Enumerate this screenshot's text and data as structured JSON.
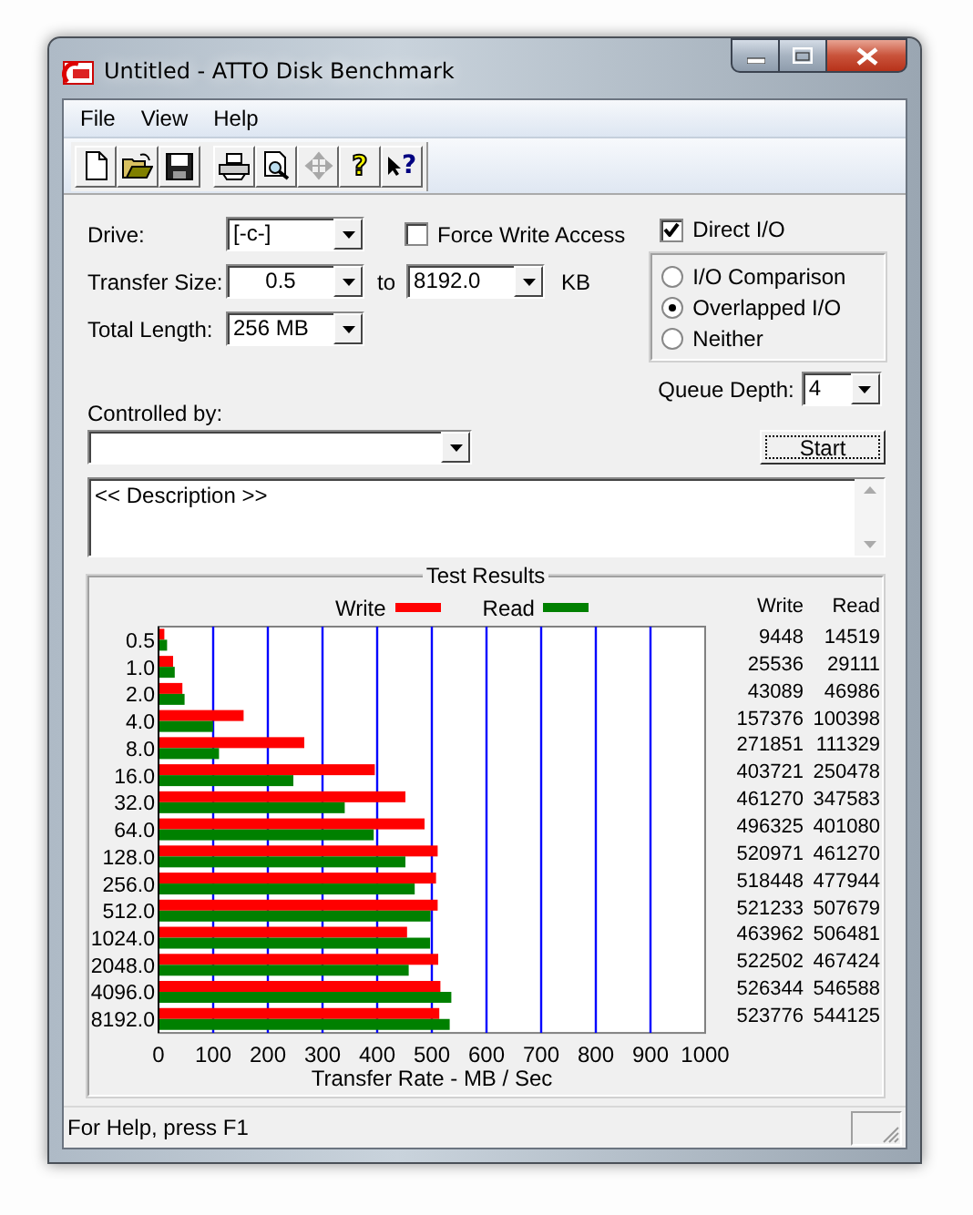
{
  "window": {
    "title": "Untitled - ATTO Disk Benchmark"
  },
  "menu": [
    "File",
    "View",
    "Help"
  ],
  "toolbar": [
    {
      "kind": "new",
      "disabled": false
    },
    {
      "kind": "open",
      "disabled": false
    },
    {
      "kind": "save",
      "disabled": false
    },
    {
      "kind": "print",
      "disabled": false
    },
    {
      "kind": "preview",
      "disabled": false
    },
    {
      "kind": "move",
      "disabled": true
    },
    {
      "kind": "help",
      "glyph": "?",
      "disabled": false
    },
    {
      "kind": "context_help",
      "glyph": "?",
      "disabled": false
    }
  ],
  "settings": {
    "drive": {
      "label": "Drive:",
      "value": "[-c-]"
    },
    "force_write_access": {
      "label": "Force Write Access",
      "checked": false
    },
    "transfer_size": {
      "label": "Transfer Size:",
      "from": "0.5",
      "to_label": "to",
      "to": "8192.0",
      "unit": "KB"
    },
    "total_length": {
      "label": "Total Length:",
      "value": "256 MB"
    },
    "direct_io": {
      "label": "Direct I/O",
      "checked": true
    },
    "io_mode": [
      {
        "label": "I/O Comparison",
        "selected": false
      },
      {
        "label": "Overlapped I/O",
        "selected": true
      },
      {
        "label": "Neither",
        "selected": false
      }
    ],
    "queue_depth": {
      "label": "Queue Depth:",
      "value": "4"
    },
    "controlled_by": {
      "label": "Controlled by:"
    },
    "start_button": "Start",
    "description": "<< Description >>"
  },
  "results": {
    "title": "Test Results",
    "columns": [
      "Write",
      "Read"
    ],
    "rows": [
      [
        "9448",
        "14519"
      ],
      [
        "25536",
        "29111"
      ],
      [
        "43089",
        "46986"
      ],
      [
        "157376",
        "100398"
      ],
      [
        "271851",
        "111329"
      ],
      [
        "403721",
        "250478"
      ],
      [
        "461270",
        "347583"
      ],
      [
        "496325",
        "401080"
      ],
      [
        "520971",
        "461270"
      ],
      [
        "518448",
        "477944"
      ],
      [
        "521233",
        "507679"
      ],
      [
        "463962",
        "506481"
      ],
      [
        "522502",
        "467424"
      ],
      [
        "526344",
        "546588"
      ],
      [
        "523776",
        "544125"
      ]
    ],
    "chart_data": {
      "type": "bar",
      "orientation": "horizontal",
      "xlabel": "Transfer Rate - MB / Sec",
      "categories": [
        "0.5",
        "1.0",
        "2.0",
        "4.0",
        "8.0",
        "16.0",
        "32.0",
        "64.0",
        "128.0",
        "256.0",
        "512.0",
        "1024.0",
        "2048.0",
        "4096.0",
        "8192.0"
      ],
      "series": [
        {
          "name": "Write",
          "color": "#ff0000",
          "values": [
            9,
            25,
            42,
            154,
            265,
            394,
            450,
            485,
            509,
            506,
            509,
            453,
            510,
            514,
            512
          ]
        },
        {
          "name": "Read",
          "color": "#008000",
          "values": [
            14,
            28,
            46,
            98,
            109,
            245,
            339,
            392,
            450,
            467,
            496,
            495,
            456,
            534,
            531
          ]
        }
      ],
      "grid": true,
      "xlim": [
        0,
        1000
      ],
      "xticks": [
        0,
        100,
        200,
        300,
        400,
        500,
        600,
        700,
        800,
        900,
        1000
      ]
    }
  },
  "status_bar": "For Help, press F1"
}
